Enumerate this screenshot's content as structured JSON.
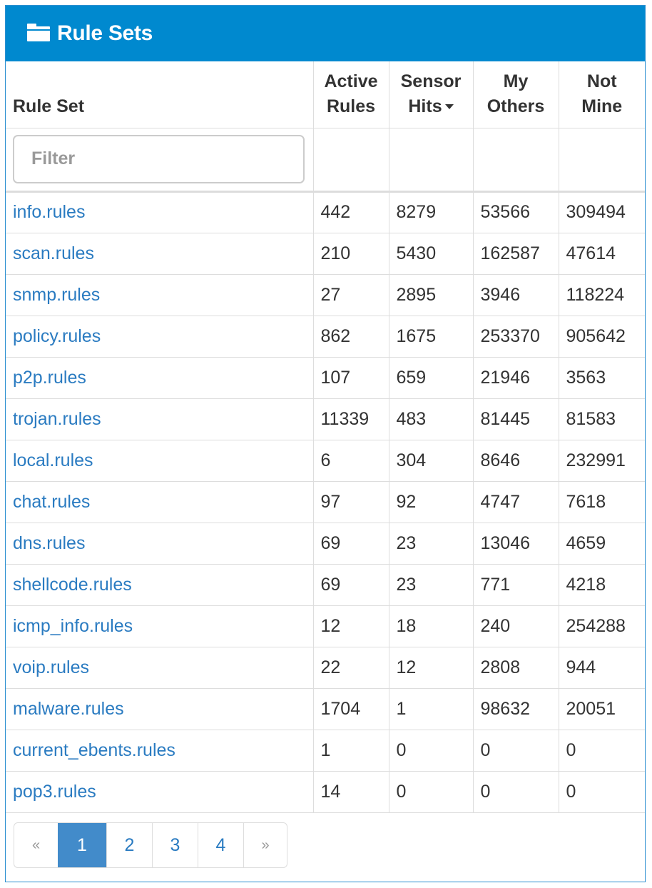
{
  "panel": {
    "title": "Rule Sets",
    "icon": "folder-icon",
    "header_color": "#0089cf"
  },
  "table": {
    "headers": {
      "rule_set": "Rule Set",
      "active_rules_line1": "Active",
      "active_rules_line2": "Rules",
      "sensor_hits_line1": "Sensor",
      "sensor_hits_line2": "Hits",
      "my_others_line1": "My",
      "my_others_line2": "Others",
      "not_mine_line1": "Not",
      "not_mine_line2": "Mine"
    },
    "filter_placeholder": "Filter",
    "rows": [
      {
        "name": "info.rules",
        "active": "442",
        "hits": "8279",
        "others": "53566",
        "not_mine": "309494"
      },
      {
        "name": "scan.rules",
        "active": "210",
        "hits": "5430",
        "others": "162587",
        "not_mine": "47614"
      },
      {
        "name": "snmp.rules",
        "active": "27",
        "hits": "2895",
        "others": "3946",
        "not_mine": "118224"
      },
      {
        "name": "policy.rules",
        "active": "862",
        "hits": "1675",
        "others": "253370",
        "not_mine": "905642"
      },
      {
        "name": "p2p.rules",
        "active": "107",
        "hits": "659",
        "others": "21946",
        "not_mine": "3563"
      },
      {
        "name": "trojan.rules",
        "active": "11339",
        "hits": "483",
        "others": "81445",
        "not_mine": "81583"
      },
      {
        "name": "local.rules",
        "active": "6",
        "hits": "304",
        "others": "8646",
        "not_mine": "232991"
      },
      {
        "name": "chat.rules",
        "active": "97",
        "hits": "92",
        "others": "4747",
        "not_mine": "7618"
      },
      {
        "name": "dns.rules",
        "active": "69",
        "hits": "23",
        "others": "13046",
        "not_mine": "4659"
      },
      {
        "name": "shellcode.rules",
        "active": "69",
        "hits": "23",
        "others": "771",
        "not_mine": "4218"
      },
      {
        "name": "icmp_info.rules",
        "active": "12",
        "hits": "18",
        "others": "240",
        "not_mine": "254288"
      },
      {
        "name": "voip.rules",
        "active": "22",
        "hits": "12",
        "others": "2808",
        "not_mine": "944"
      },
      {
        "name": "malware.rules",
        "active": "1704",
        "hits": "1",
        "others": "98632",
        "not_mine": "20051"
      },
      {
        "name": "current_ebents.rules",
        "active": "1",
        "hits": "0",
        "others": "0",
        "not_mine": "0"
      },
      {
        "name": "pop3.rules",
        "active": "14",
        "hits": "0",
        "others": "0",
        "not_mine": "0"
      }
    ]
  },
  "pagination": {
    "prev": "«",
    "next": "»",
    "pages": [
      "1",
      "2",
      "3",
      "4"
    ],
    "active_page": "1"
  },
  "colors": {
    "link": "#2a7bc1",
    "active_page": "#428bca",
    "border": "#dddddd"
  }
}
